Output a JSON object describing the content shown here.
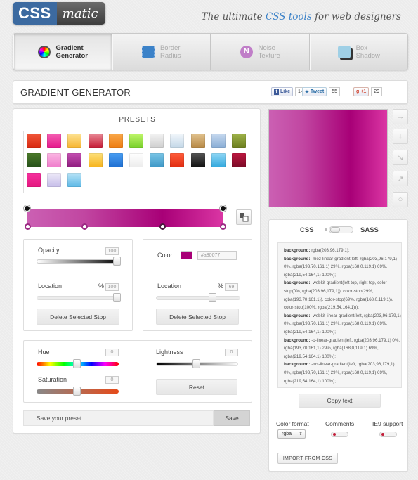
{
  "header": {
    "logo_css": "CSS",
    "logo_matic": "matic",
    "tagline_pre": "The ultimate ",
    "tagline_highlight": "CSS tools",
    "tagline_post": " for web designers"
  },
  "tabs": [
    {
      "line1": "Gradient",
      "line2": "Generator",
      "icon": "color-wheel-icon",
      "active": true
    },
    {
      "line1": "Border",
      "line2": "Radius",
      "icon": "border-radius-icon",
      "active": false
    },
    {
      "line1": "Noise",
      "line2": "Texture",
      "icon": "noise-icon",
      "active": false
    },
    {
      "line1": "Box",
      "line2": "Shadow",
      "icon": "box-shadow-icon",
      "active": false
    }
  ],
  "title": "GRADIENT GENERATOR",
  "social": {
    "like_label": "Like",
    "like_count": "1k",
    "tweet_label": "Tweet",
    "tweet_count": "55",
    "gplus_label": "+1",
    "gplus_count": "29"
  },
  "presets": {
    "title": "PRESETS",
    "rows": [
      [
        "linear-gradient(#f0563a,#d92b12)",
        "linear-gradient(#f45fb2,#e61a8d)",
        "linear-gradient(#fde293,#f7b733)",
        "linear-gradient(#e98996,#c61e38)",
        "linear-gradient(#f9a84a,#ee7e14)",
        "linear-gradient(#c0f66b,#7ad12c)",
        "linear-gradient(#f3f3f3,#cfcfcf)",
        "linear-gradient(#f2f7fb,#c4d8e8)",
        "linear-gradient(#e1c28e,#b88a47)",
        "linear-gradient(#c7d9ef,#8aaed6)",
        "linear-gradient(#9fb34a,#6d7f1f)"
      ],
      [
        "linear-gradient(#4b7a2a,#26501a)",
        "linear-gradient(#fbb6e3,#ef7ccb)",
        "linear-gradient(#c44fb1,#8e1c7e)",
        "linear-gradient(#fde07a,#f6b31c)",
        "linear-gradient(#4a9ef3,#1f6fd1)",
        "linear-gradient(#ffffff,#ececec)",
        "linear-gradient(#7ac5e6,#3d97c6)",
        "linear-gradient(#ff5d3b,#e12c10)",
        "linear-gradient(#555555,#111111)",
        "linear-gradient(#8fd6f5,#32a8dd)",
        "linear-gradient(#bd1740,#7a0a26)"
      ],
      [
        "linear-gradient(#f6309e,#e4187f)",
        "linear-gradient(#eeeaf8,#c6bde9)",
        "linear-gradient(#b9e4f7,#5db8e6)"
      ]
    ]
  },
  "stops_panel": {
    "opacity_label": "Opacity",
    "opacity_value": "100",
    "location_label": "Location",
    "location_unit": "%",
    "location_value": "100",
    "delete_label": "Delete Selected Stop",
    "opacity_level": 100,
    "location_level": 100
  },
  "color_panel": {
    "color_label": "Color",
    "color_hex": "#a80077",
    "location_label": "Location",
    "location_unit": "%",
    "location_value": "69",
    "delete_label": "Delete Selected Stop",
    "location_level": 69
  },
  "adjust_panel": {
    "hue_label": "Hue",
    "hue_value": "0",
    "lightness_label": "Lightness",
    "lightness_value": "0",
    "saturation_label": "Saturation",
    "saturation_value": "0",
    "reset_label": "Reset"
  },
  "save": {
    "placeholder": "Save your preset",
    "button": "Save"
  },
  "output": {
    "css_label": "CSS",
    "sass_label": "SASS",
    "code_lines": [
      {
        "k": "background:",
        "v": " rgba(203,96,179,1);"
      },
      {
        "k": "background:",
        "v": " -moz-linear-gradient(left, rgba(203,96,179,1) 0%, rgba(193,70,161,1) 29%, rgba(168,0,119,1) 69%, rgba(219,54,164,1) 100%);"
      },
      {
        "k": "background:",
        "v": " -webkit-gradient(left top, right top, color-stop(0%, rgba(203,96,179,1)), color-stop(29%, rgba(193,70,161,1)), color-stop(69%, rgba(168,0,119,1)), color-stop(100%, rgba(219,54,164,1)));"
      },
      {
        "k": "background:",
        "v": " -webkit-linear-gradient(left, rgba(203,96,179,1) 0%, rgba(193,70,161,1) 29%, rgba(168,0,119,1) 69%, rgba(219,54,164,1) 100%);"
      },
      {
        "k": "background:",
        "v": " -o-linear-gradient(left, rgba(203,96,179,1) 0%, rgba(193,70,161,1) 29%, rgba(168,0,119,1) 69%, rgba(219,54,164,1) 100%);"
      },
      {
        "k": "background:",
        "v": " -ms-linear-gradient(left, rgba(203,96,179,1) 0%, rgba(193,70,161,1) 29%, rgba(168,0,119,1) 69%, rgba(219,54,164,1) 100%);"
      }
    ],
    "copy_label": "Copy text",
    "color_format_label": "Color format",
    "color_format_value": "rgba",
    "comments_label": "Comments",
    "ie9_label": "IE9 support",
    "import_label": "IMPORT FROM CSS"
  },
  "colors": {
    "accent_blue": "#3c82c8",
    "selected_color": "#a80077",
    "gradient_stops": [
      "#cb60b3",
      "#c146a1",
      "#a80077",
      "#db36a4"
    ]
  },
  "direction_buttons": [
    "arrow-right-icon",
    "arrow-down-icon",
    "arrow-diagonal-down-right-icon",
    "arrow-diagonal-up-right-icon",
    "radial-circle-icon"
  ]
}
